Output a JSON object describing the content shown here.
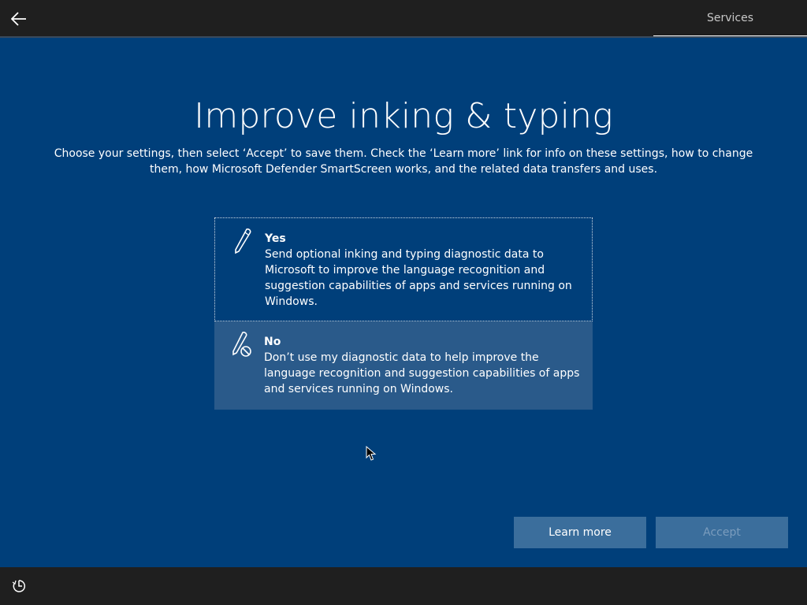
{
  "header": {
    "back_icon": "arrow-left-icon",
    "tab_label": "Services"
  },
  "main": {
    "title": "Improve inking & typing",
    "subtitle": "Choose your settings, then select ‘Accept’ to save them. Check the ‘Learn more’ link for info on these settings, how to change them, how Microsoft Defender SmartScreen works, and the related data transfers and uses.",
    "options": [
      {
        "title": "Yes",
        "description": "Send optional inking and typing diagnostic data to Microsoft to improve the language recognition and suggestion capabilities of apps and services running on Windows.",
        "icon": "pen-icon",
        "selected": true
      },
      {
        "title": "No",
        "description": "Don’t use my diagnostic data to help improve the language recognition and suggestion capabilities of apps and services running on Windows.",
        "icon": "pen-disabled-icon",
        "selected": false,
        "hovered": true
      }
    ]
  },
  "footer": {
    "learn_more_label": "Learn more",
    "accept_label": "Accept",
    "accept_enabled": false,
    "accessibility_icon": "ease-of-access-icon"
  },
  "colors": {
    "background": "#003f7a",
    "bar": "#1f1f1f",
    "button": "#3b6e9c",
    "hover_option": "#2a5a8a"
  }
}
